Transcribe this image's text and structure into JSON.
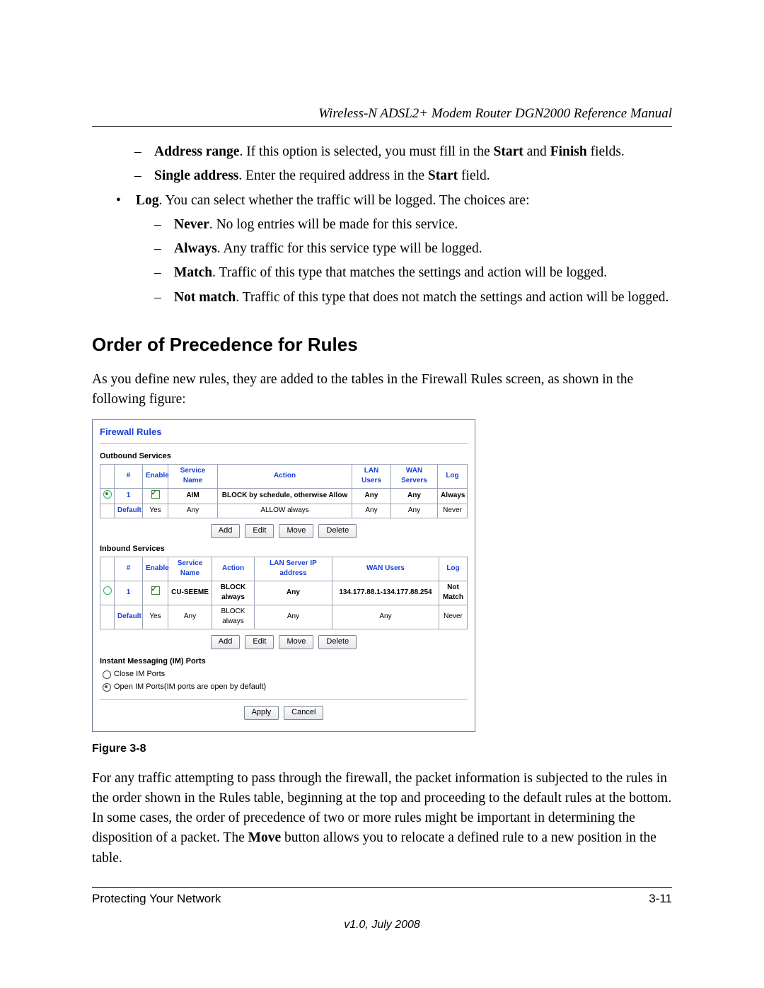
{
  "header": {
    "title": "Wireless-N ADSL2+ Modem Router DGN2000 Reference Manual"
  },
  "list_top": {
    "address_range": {
      "bold": "Address range",
      "rest": ". If this option is selected, you must fill in the ",
      "b2": "Start",
      "mid": " and ",
      "b3": "Finish",
      "tail": " fields."
    },
    "single_addr": {
      "bold": "Single address",
      "rest": ". Enter the required address in the ",
      "b2": "Start",
      "tail": " field."
    },
    "log_intro": {
      "bold": "Log",
      "rest": ". You can select whether the traffic will be logged. The choices are:"
    },
    "never": {
      "bold": "Never",
      "rest": ". No log entries will be made for this service."
    },
    "always": {
      "bold": "Always",
      "rest": ". Any traffic for this service type will be logged."
    },
    "match": {
      "bold": "Match",
      "rest": ". Traffic of this type that matches the settings and action will be logged."
    },
    "not_match": {
      "bold": "Not match",
      "rest": ". Traffic of this type that does not match the settings and action will be logged."
    }
  },
  "section_heading": "Order of Precedence for Rules",
  "intro_para": "As you define new rules, they are added to the tables in the Firewall Rules screen, as shown in the following figure:",
  "figure": {
    "title": "Firewall Rules",
    "outbound_label": "Outbound Services",
    "inbound_label": "Inbound Services",
    "im_label": "Instant Messaging (IM) Ports",
    "im_close": "Close IM Ports",
    "im_open": "Open IM Ports(IM ports are open by default)",
    "buttons": {
      "add": "Add",
      "edit": "Edit",
      "move": "Move",
      "delete": "Delete",
      "apply": "Apply",
      "cancel": "Cancel"
    },
    "outbound": {
      "headers": [
        "#",
        "Enable",
        "Service Name",
        "Action",
        "LAN Users",
        "WAN Servers",
        "Log"
      ],
      "rows": [
        {
          "sel": "on",
          "num": "1",
          "enable": true,
          "svc": "AIM",
          "action": "BLOCK by schedule, otherwise Allow",
          "lan": "Any",
          "wan": "Any",
          "log": "Always"
        },
        {
          "sel": "",
          "num": "Default",
          "enable_text": "Yes",
          "svc": "Any",
          "action": "ALLOW always",
          "lan": "Any",
          "wan": "Any",
          "log": "Never"
        }
      ]
    },
    "inbound": {
      "headers": [
        "#",
        "Enable",
        "Service Name",
        "Action",
        "LAN Server IP address",
        "WAN Users",
        "Log"
      ],
      "rows": [
        {
          "sel": "off",
          "num": "1",
          "enable": true,
          "svc": "CU-SEEME",
          "action": "BLOCK always",
          "lan": "Any",
          "wan": "134.177.88.1-134.177.88.254",
          "log": "Not Match"
        },
        {
          "sel": "",
          "num": "Default",
          "enable_text": "Yes",
          "svc": "Any",
          "action": "BLOCK always",
          "lan": "Any",
          "wan": "Any",
          "log": "Never"
        }
      ]
    }
  },
  "figure_caption": "Figure 3-8",
  "bottom_para": {
    "t1": "For any traffic attempting to pass through the firewall, the packet information is subjected to the rules in the order shown in the Rules table, beginning at the top and proceeding to the default rules at the bottom. In some cases, the order of precedence of two or more rules might be important in determining the disposition of a packet. The ",
    "b": "Move",
    "t2": " button allows you to relocate a defined rule to a new position in the table."
  },
  "footer": {
    "left": "Protecting Your Network",
    "right": "3-11",
    "version": "v1.0, July 2008"
  }
}
